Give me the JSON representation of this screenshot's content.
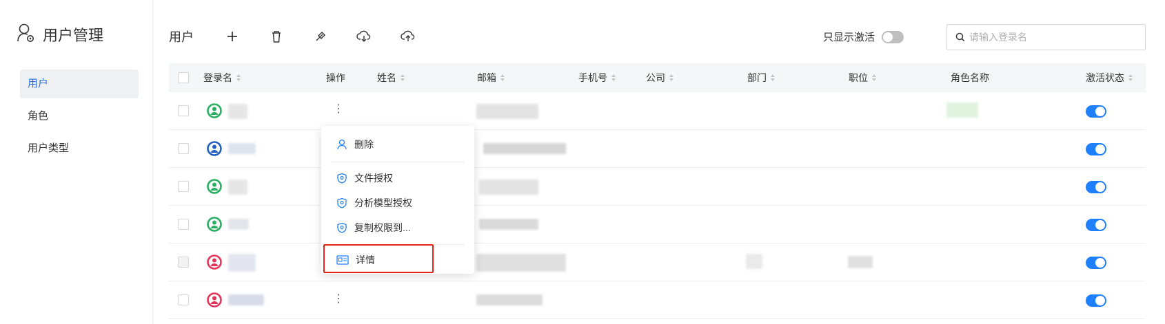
{
  "sidebar": {
    "title": "用户管理",
    "items": [
      {
        "label": "用户",
        "active": true
      },
      {
        "label": "角色",
        "active": false
      },
      {
        "label": "用户类型",
        "active": false
      }
    ]
  },
  "toolbar": {
    "title": "用户",
    "buttons": [
      "add-icon",
      "delete-icon",
      "sync-icon",
      "cloud-download-icon",
      "cloud-upload-icon"
    ],
    "active_only_label": "只显示激活",
    "active_only_on": false,
    "search_placeholder": "请输入登录名"
  },
  "table": {
    "columns": [
      {
        "label": "登录名",
        "sortable": true
      },
      {
        "label": "操作",
        "sortable": false
      },
      {
        "label": "姓名",
        "sortable": true
      },
      {
        "label": "邮箱",
        "sortable": true
      },
      {
        "label": "手机号",
        "sortable": true
      },
      {
        "label": "公司",
        "sortable": true
      },
      {
        "label": "部门",
        "sortable": true
      },
      {
        "label": "职位",
        "sortable": true
      },
      {
        "label": "角色名称",
        "sortable": false
      },
      {
        "label": "激活状态",
        "sortable": true
      }
    ],
    "rows": [
      {
        "avatar_color": "#27ae60",
        "active": true
      },
      {
        "avatar_color": "#1f5fbf",
        "active": true
      },
      {
        "avatar_color": "#27ae60",
        "active": true
      },
      {
        "avatar_color": "#27ae60",
        "active": true
      },
      {
        "avatar_color": "#e3335a",
        "active": true
      },
      {
        "avatar_color": "#e3335a",
        "active": true
      }
    ]
  },
  "context_menu": {
    "items": [
      {
        "label": "删除",
        "icon": "user-icon"
      },
      {
        "label": "文件授权",
        "icon": "shield-icon"
      },
      {
        "label": "分析模型授权",
        "icon": "shield-icon"
      },
      {
        "label": "复制权限到...",
        "icon": "shield-icon"
      },
      {
        "label": "详情",
        "icon": "id-card-icon",
        "highlighted": true
      }
    ]
  },
  "colors": {
    "accent": "#1e80ff",
    "highlight_border": "#e8221b"
  }
}
